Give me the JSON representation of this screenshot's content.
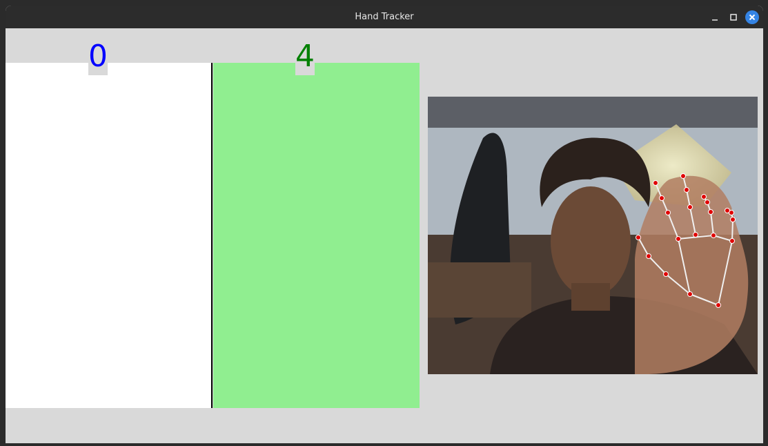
{
  "window": {
    "title": "Hand Tracker"
  },
  "counters": {
    "left_value": "0",
    "right_value": "4"
  },
  "colors": {
    "left_counter": "#0000ff",
    "right_counter": "#008000",
    "left_panel": "#ffffff",
    "right_panel": "#90ee90",
    "landmark": "#e00000",
    "connection": "#f0f0f0"
  },
  "icons": {
    "minimize": "minimize-icon",
    "maximize": "maximize-icon",
    "close": "close-icon"
  }
}
